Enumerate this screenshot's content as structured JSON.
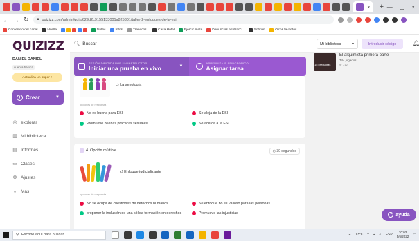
{
  "browser": {
    "tab_close": "×",
    "new_tab": "+",
    "url": "quizizz.com/admin/quiz/629d2c9155133001a825301/taller-2-enfoques-de-la-esi",
    "win_controls": [
      "—",
      "▢",
      "×"
    ],
    "bookmarks": [
      "Contenido del canal",
      "Huella",
      "Nutric",
      "Infosl",
      "Tranccos |",
      "Casa Hotel",
      "Ejercic mate",
      "Denuncias e Infracc...",
      "Sobrolo",
      "Otros favoritos"
    ]
  },
  "sidebar": {
    "logo": "QUIZIZZ",
    "user_name": "DANIEL DANIEL",
    "user_sub": "cuenta basica",
    "upgrade": "Actualiza un super ↑",
    "create": "Crear",
    "nav": [
      {
        "label": "explorar",
        "icon": "compass-icon",
        "glyph": "◎"
      },
      {
        "label": "Mi biblioteca",
        "icon": "library-icon",
        "glyph": "▥"
      },
      {
        "label": "Informes",
        "icon": "reports-icon",
        "glyph": "▤"
      },
      {
        "label": "Clases",
        "icon": "classes-icon",
        "glyph": "▭"
      },
      {
        "label": "Ajustes",
        "icon": "settings-icon",
        "glyph": "⚙"
      },
      {
        "label": "Más",
        "icon": "chevron-down-icon",
        "glyph": "⌄"
      }
    ]
  },
  "topbar": {
    "search": "Buscar",
    "library": "Mi biblioteca",
    "code_button": "Introducir código"
  },
  "promo": {
    "live_small": "SESIÓN DIRIGIDA POR UN INSTRUCTOR",
    "live_big": "Iniciar una prueba en vivo",
    "assign_small": "APRENDIZAJE ASINCRÓNICO",
    "assign_big": "Asignar tarea"
  },
  "right_panel": {
    "thumb_text": "15 preguntas",
    "title": "El alquimista primera parte",
    "meta": "744 jugados",
    "meta2": "9° - 12"
  },
  "question3": {
    "title": "c) La sexología",
    "options_label": "opciones de respuesta",
    "options": [
      {
        "text": "No es buena para ESI",
        "color": "#ec0b43"
      },
      {
        "text": "Se aleja de la ESI",
        "color": "#ec0b43"
      },
      {
        "text": "Promueve buenas practicas sexuales",
        "color": "#00c985"
      },
      {
        "text": "Se acerca a la ESI",
        "color": "#00c985"
      }
    ]
  },
  "question4": {
    "header": "4. Opción múltiple",
    "time": "30 segundos",
    "title": "c) Enfoque judicializante",
    "options_label": "opciones de respuesta",
    "options": [
      {
        "text": "No se ocupa de cuestiones de derechos humanos",
        "color": "#ec0b43"
      },
      {
        "text": "Su enfoque no es valioso para las personas",
        "color": "#ec0b43"
      },
      {
        "text": "proponer la inclusión de una sólida formación en derechos",
        "color": "#00c985"
      },
      {
        "text": "Promueve las injusticias",
        "color": "#ec0b43"
      }
    ]
  },
  "help": "ayuda",
  "taskbar": {
    "search": "Escribe aquí para buscar",
    "weather": "13°C",
    "lang": "ESP",
    "time": "20:03",
    "date": "5/6/2022"
  }
}
